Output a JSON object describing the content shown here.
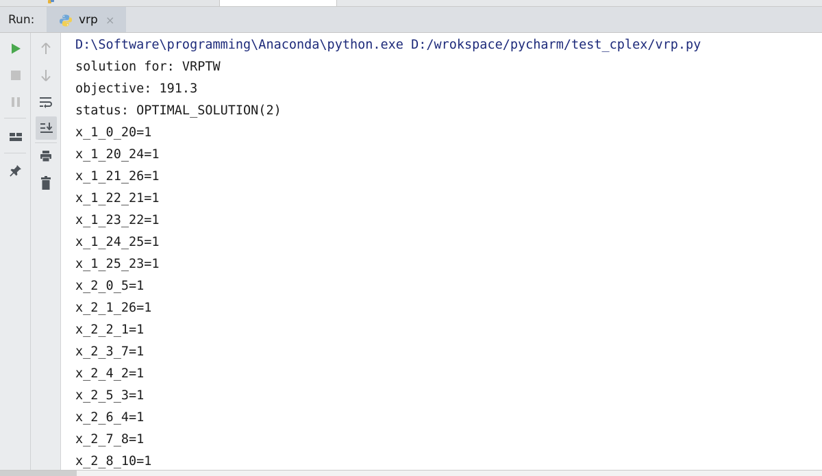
{
  "run_panel": {
    "label": "Run:",
    "tab": {
      "label": "vrp",
      "close_glyph": "×",
      "icon": "python-file-icon"
    }
  },
  "toolbar_left": [
    {
      "name": "rerun-button",
      "icon": "play-icon",
      "color": "#4aa84e"
    },
    {
      "name": "stop-button",
      "icon": "stop-icon",
      "color": "#c2c2c2"
    },
    {
      "name": "pause-button",
      "icon": "pause-icon",
      "color": "#c2c2c2"
    },
    {
      "name": "restore-layout-button",
      "icon": "layout-icon",
      "color": "#4f555b"
    },
    {
      "name": "pin-tab-button",
      "icon": "pin-icon",
      "color": "#4f555b"
    }
  ],
  "toolbar_right": [
    {
      "name": "scroll-up-button",
      "icon": "arrow-up-icon",
      "color": "#b6b6b6"
    },
    {
      "name": "scroll-down-button",
      "icon": "arrow-down-icon",
      "color": "#b6b6b6"
    },
    {
      "name": "soft-wrap-button",
      "icon": "soft-wrap-icon",
      "color": "#4f555b"
    },
    {
      "name": "scroll-to-end-button",
      "icon": "scroll-to-end-icon",
      "color": "#4f555b",
      "active": true
    },
    {
      "name": "print-button",
      "icon": "print-icon",
      "color": "#4f555b"
    },
    {
      "name": "clear-all-button",
      "icon": "trash-icon",
      "color": "#4f555b"
    }
  ],
  "console": {
    "lines": [
      "D:\\Software\\programming\\Anaconda\\python.exe D:/wrokspace/pycharm/test_cplex/vrp.py",
      "solution for: VRPTW",
      "objective: 191.3",
      "status: OPTIMAL_SOLUTION(2)",
      "x_1_0_20=1",
      "x_1_20_24=1",
      "x_1_21_26=1",
      "x_1_22_21=1",
      "x_1_23_22=1",
      "x_1_24_25=1",
      "x_1_25_23=1",
      "x_2_0_5=1",
      "x_2_1_26=1",
      "x_2_2_1=1",
      "x_2_3_7=1",
      "x_2_4_2=1",
      "x_2_5_3=1",
      "x_2_6_4=1",
      "x_2_7_8=1",
      "x_2_8_10=1"
    ],
    "command_color": "#1d2a7a",
    "text_color": "#1b1b1b"
  }
}
